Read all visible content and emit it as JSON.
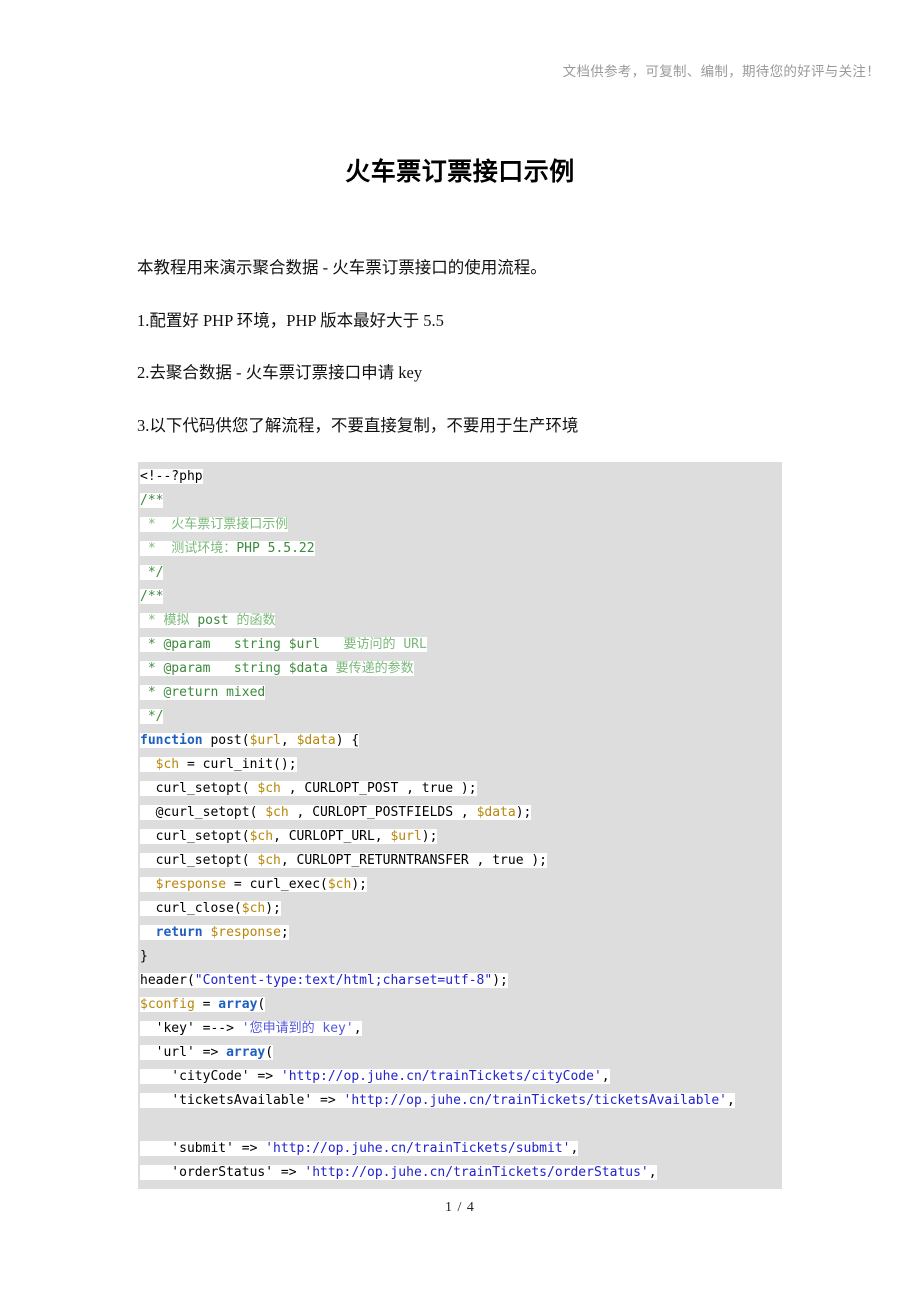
{
  "header": {
    "note": "文档供参考，可复制、编制，期待您的好评与关注！"
  },
  "title": "火车票订票接口示例",
  "body": {
    "paragraphs": [
      "本教程用来演示聚合数据 - 火车票订票接口的使用流程。",
      "1.配置好 PHP 环境，PHP 版本最好大于 5.5",
      "2.去聚合数据 - 火车票订票接口申请 key",
      "3.以下代码供您了解流程，不要直接复制，不要用于生产环境"
    ]
  },
  "code": {
    "language": "php",
    "lines": [
      "<!--?php",
      "/**",
      " *  火车票订票接口示例",
      " *  测试环境：PHP 5.5.22",
      " */",
      "/**",
      " * 模拟 post 的函数",
      " * @param   string $url   要访问的 URL",
      " * @param   string $data  要传递的参数",
      " * @return mixed",
      " */",
      "function post($url, $data) {",
      "  $ch = curl_init();",
      "  curl_setopt( $ch , CURLOPT_POST , true );",
      "  @curl_setopt( $ch , CURLOPT_POSTFIELDS , $data);",
      "  curl_setopt($ch, CURLOPT_URL, $url);",
      "  curl_setopt( $ch, CURLOPT_RETURNTRANSFER , true );",
      "  $response = curl_exec($ch);",
      "  curl_close($ch);",
      "  return $response;",
      "}",
      "header(\"Content-type:text/html;charset=utf-8\");",
      "$config = array(",
      "  'key' =--> '您申请到的 key',",
      "  'url' => array(",
      "    'cityCode' => 'http://op.juhe.cn/trainTickets/cityCode',",
      "    'ticketsAvailable' => 'http://op.juhe.cn/trainTickets/ticketsAvailable',",
      "    'submit' => 'http://op.juhe.cn/trainTickets/submit',",
      "    'orderStatus' => 'http://op.juhe.cn/trainTickets/orderStatus',"
    ]
  },
  "footer": {
    "page_indicator": "1 / 4"
  },
  "colors": {
    "code_background": "#dddddd",
    "line_highlight": "#ffffff",
    "comment": "#3c8a3c",
    "keyword": "#1f5fbf",
    "variable": "#b8860b",
    "string": "#2222cc",
    "header_note": "#9a9a9a",
    "text": "#111111"
  }
}
